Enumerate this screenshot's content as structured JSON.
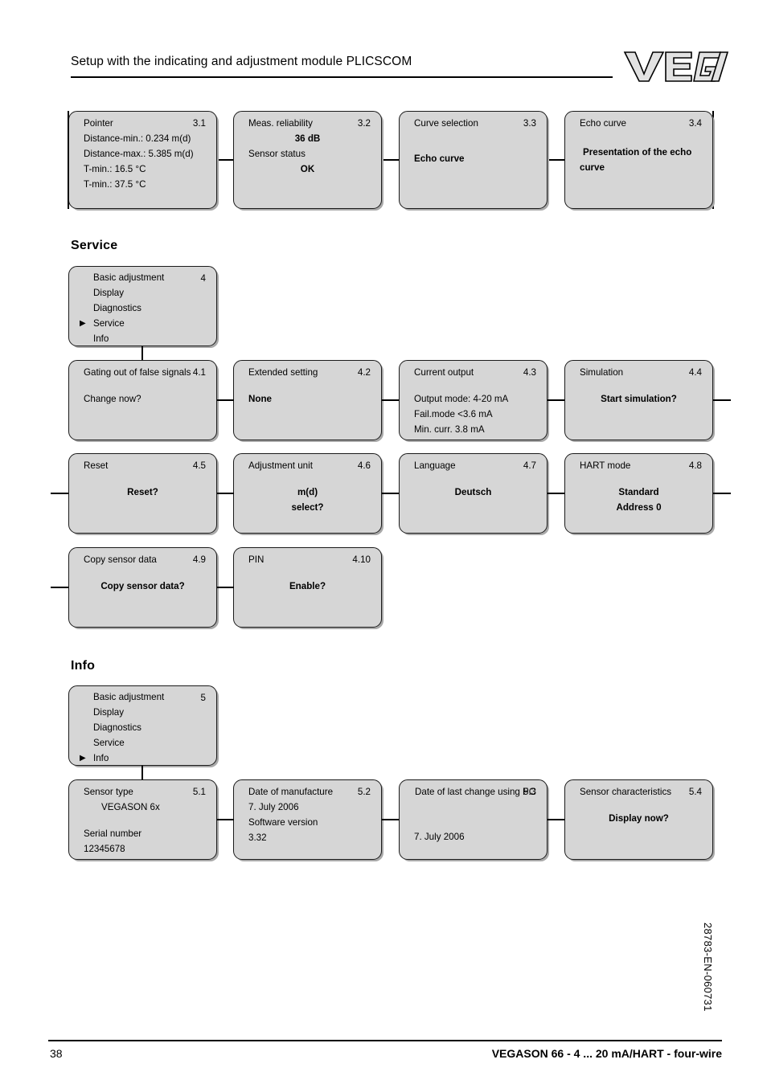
{
  "header": {
    "title": "Setup with the indicating and adjustment module PLICSCOM",
    "logo_text": "VEGA"
  },
  "sections": [
    {
      "key": "service",
      "title": "Service"
    },
    {
      "key": "info",
      "title": "Info"
    }
  ],
  "diagnostics_row": [
    {
      "title": "Pointer",
      "number": "3.1",
      "lines": [
        {
          "text": "Distance-min.: 0.234 m(d)",
          "bold": false
        },
        {
          "text": "Distance-max.: 5.385 m(d)",
          "bold": false
        },
        {
          "text": "T-min.: 16.5 °C",
          "bold": false
        },
        {
          "text": "T-min.: 37.5 °C",
          "bold": false
        }
      ]
    },
    {
      "title": "Meas. reliability",
      "number": "3.2",
      "lines": [
        {
          "text": "36 dB",
          "bold": true,
          "center": true
        },
        {
          "text": "Sensor status",
          "bold": false
        },
        {
          "text": "OK",
          "bold": true,
          "center": true
        }
      ]
    },
    {
      "title": "Curve selection",
      "number": "3.3",
      "lines": [
        {
          "text": "Echo curve",
          "bold": true
        }
      ]
    },
    {
      "title": "Echo curve",
      "number": "3.4",
      "lines": [
        {
          "text": "Presentation of the echo",
          "bold": true
        },
        {
          "text": "curve",
          "bold": true
        }
      ]
    }
  ],
  "service_menu": {
    "number": "4",
    "items": [
      {
        "label": "Basic adjustment",
        "selected": false
      },
      {
        "label": "Display",
        "selected": false
      },
      {
        "label": "Diagnostics",
        "selected": false
      },
      {
        "label": "Service",
        "selected": true
      },
      {
        "label": "Info",
        "selected": false
      }
    ]
  },
  "service_row_1": [
    {
      "title": "Gating out of false signals",
      "number": "4.1",
      "lines": [
        {
          "text": "Change now?",
          "bold": false
        }
      ]
    },
    {
      "title": "Extended setting",
      "number": "4.2",
      "lines": [
        {
          "text": "None",
          "bold": true
        }
      ]
    },
    {
      "title": "Current output",
      "number": "4.3",
      "lines": [
        {
          "text": "Output mode: 4-20 mA",
          "bold": false
        },
        {
          "text": "Fail.mode <3.6 mA",
          "bold": false
        },
        {
          "text": "Min. curr. 3.8 mA",
          "bold": false
        }
      ]
    },
    {
      "title": "Simulation",
      "number": "4.4",
      "lines": [
        {
          "text": "Start simulation?",
          "bold": true,
          "center": true
        }
      ]
    }
  ],
  "service_row_2": [
    {
      "title": "Reset",
      "number": "4.5",
      "lines": [
        {
          "text": "Reset?",
          "bold": true,
          "center": true
        }
      ]
    },
    {
      "title": "Adjustment unit",
      "number": "4.6",
      "lines": [
        {
          "text": "m(d)",
          "bold": true,
          "center": true
        },
        {
          "text": "select?",
          "bold": true,
          "center": true
        }
      ]
    },
    {
      "title": "Language",
      "number": "4.7",
      "lines": [
        {
          "text": "Deutsch",
          "bold": true,
          "center": true
        }
      ]
    },
    {
      "title": "HART mode",
      "number": "4.8",
      "lines": [
        {
          "text": "Standard",
          "bold": true,
          "center": true
        },
        {
          "text": "Address 0",
          "bold": true,
          "center": true
        }
      ]
    }
  ],
  "service_row_3": [
    {
      "title": "Copy sensor data",
      "number": "4.9",
      "lines": [
        {
          "text": "Copy sensor data?",
          "bold": true,
          "center": true
        }
      ]
    },
    {
      "title": "PIN",
      "number": "4.10",
      "lines": [
        {
          "text": "Enable?",
          "bold": true,
          "center": true
        }
      ]
    }
  ],
  "info_menu": {
    "number": "5",
    "items": [
      {
        "label": "Basic adjustment",
        "selected": false
      },
      {
        "label": "Display",
        "selected": false
      },
      {
        "label": "Diagnostics",
        "selected": false
      },
      {
        "label": "Service",
        "selected": false
      },
      {
        "label": "Info",
        "selected": true
      }
    ]
  },
  "info_row": [
    {
      "title": "Sensor type",
      "number": "5.1",
      "lines": [
        {
          "text": "VEGASON 6x",
          "bold": false,
          "indent": true
        },
        {
          "text": "Serial number",
          "bold": false
        },
        {
          "text": "12345678",
          "bold": false
        }
      ]
    },
    {
      "title": "Date of manufacture",
      "number": "5.2",
      "lines": [
        {
          "text": "7. July 2006",
          "bold": false
        },
        {
          "text": "Software version",
          "bold": false
        },
        {
          "text": "3.32",
          "bold": false
        }
      ]
    },
    {
      "title": "Date of last change using PC",
      "number": "5.3",
      "lines": [
        {
          "text": "7. July 2006",
          "bold": false
        }
      ]
    },
    {
      "title": "Sensor characteristics",
      "number": "5.4",
      "lines": [
        {
          "text": "Display now?",
          "bold": true,
          "center": true
        }
      ]
    }
  ],
  "footer": {
    "page_number": "38",
    "document_line": "VEGASON 66 - 4 ... 20 mA/HART - four-wire",
    "sidebar_code": "28783-EN-060731"
  },
  "icons": {
    "selection_arrow": "▶"
  }
}
